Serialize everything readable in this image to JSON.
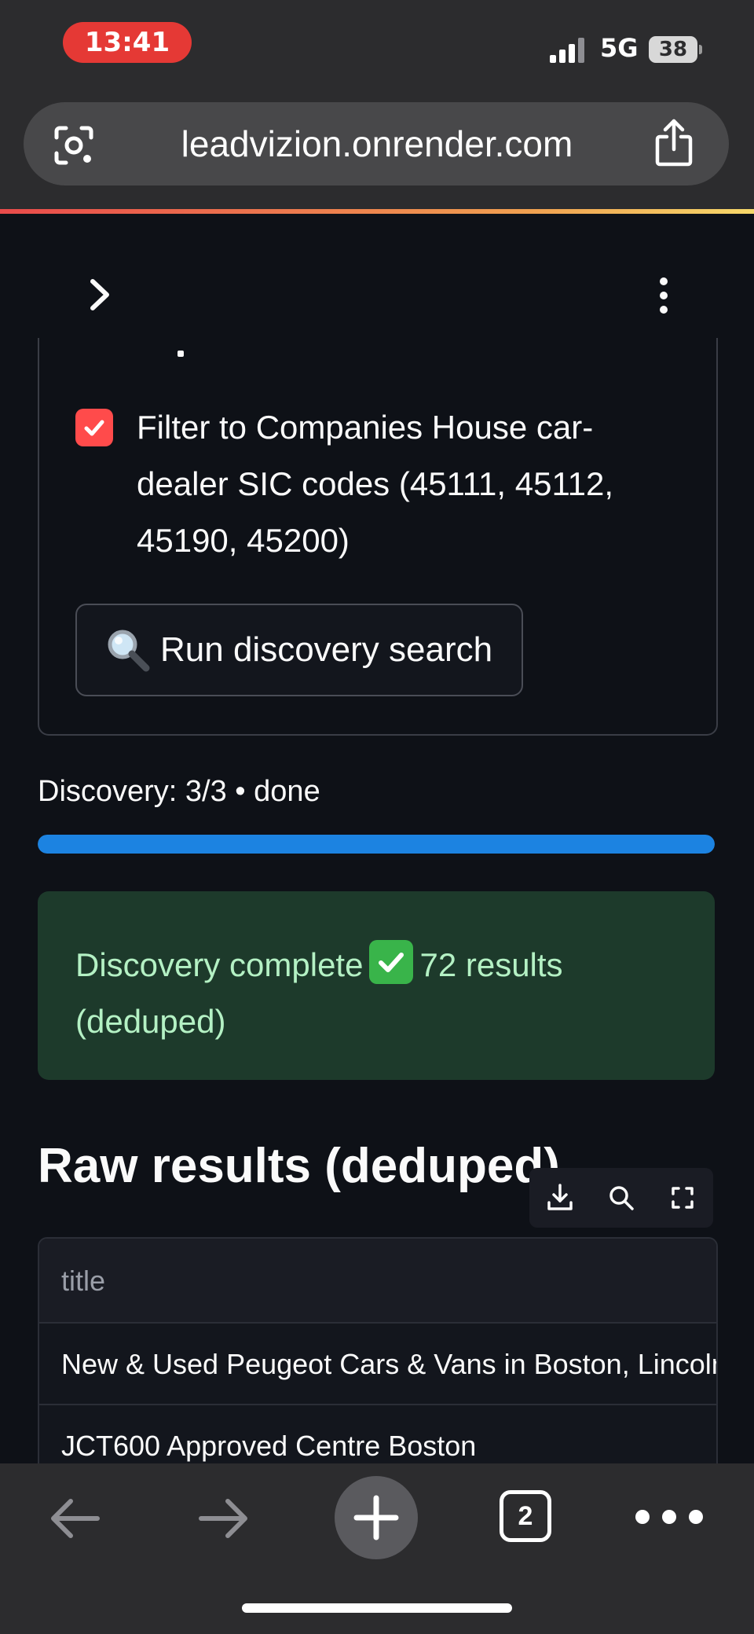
{
  "status_bar": {
    "time": "13:41",
    "network": "5G",
    "battery": "38"
  },
  "browser": {
    "url": "leadvizion.onrender.com",
    "open_tabs": "2"
  },
  "app_header": {
    "sidebar_toggle_icon": "chevron-right-icon",
    "menu_icon": "kebab-menu-icon"
  },
  "form": {
    "checkbox_checked": true,
    "checkbox_label": "Filter to Companies House car-dealer SIC codes (45111, 45112, 45190, 45200)",
    "run_button_label": "Run discovery search"
  },
  "progress": {
    "label": "Discovery: 3/3 • done",
    "fraction": 1.0
  },
  "alert": {
    "text_before": "Discovery complete",
    "text_after": "72 results (deduped)"
  },
  "results": {
    "title": "Raw results (deduped)",
    "columns": [
      "title"
    ],
    "rows": [
      "New & Used Peugeot Cars & Vans in Boston, Lincolnshire",
      "JCT600 Approved Centre Boston"
    ]
  },
  "colors": {
    "accent_red": "#ff4b4b",
    "progress_blue": "#1c83e1",
    "success_bg": "#1d3a2b",
    "background": "#0e1117"
  }
}
